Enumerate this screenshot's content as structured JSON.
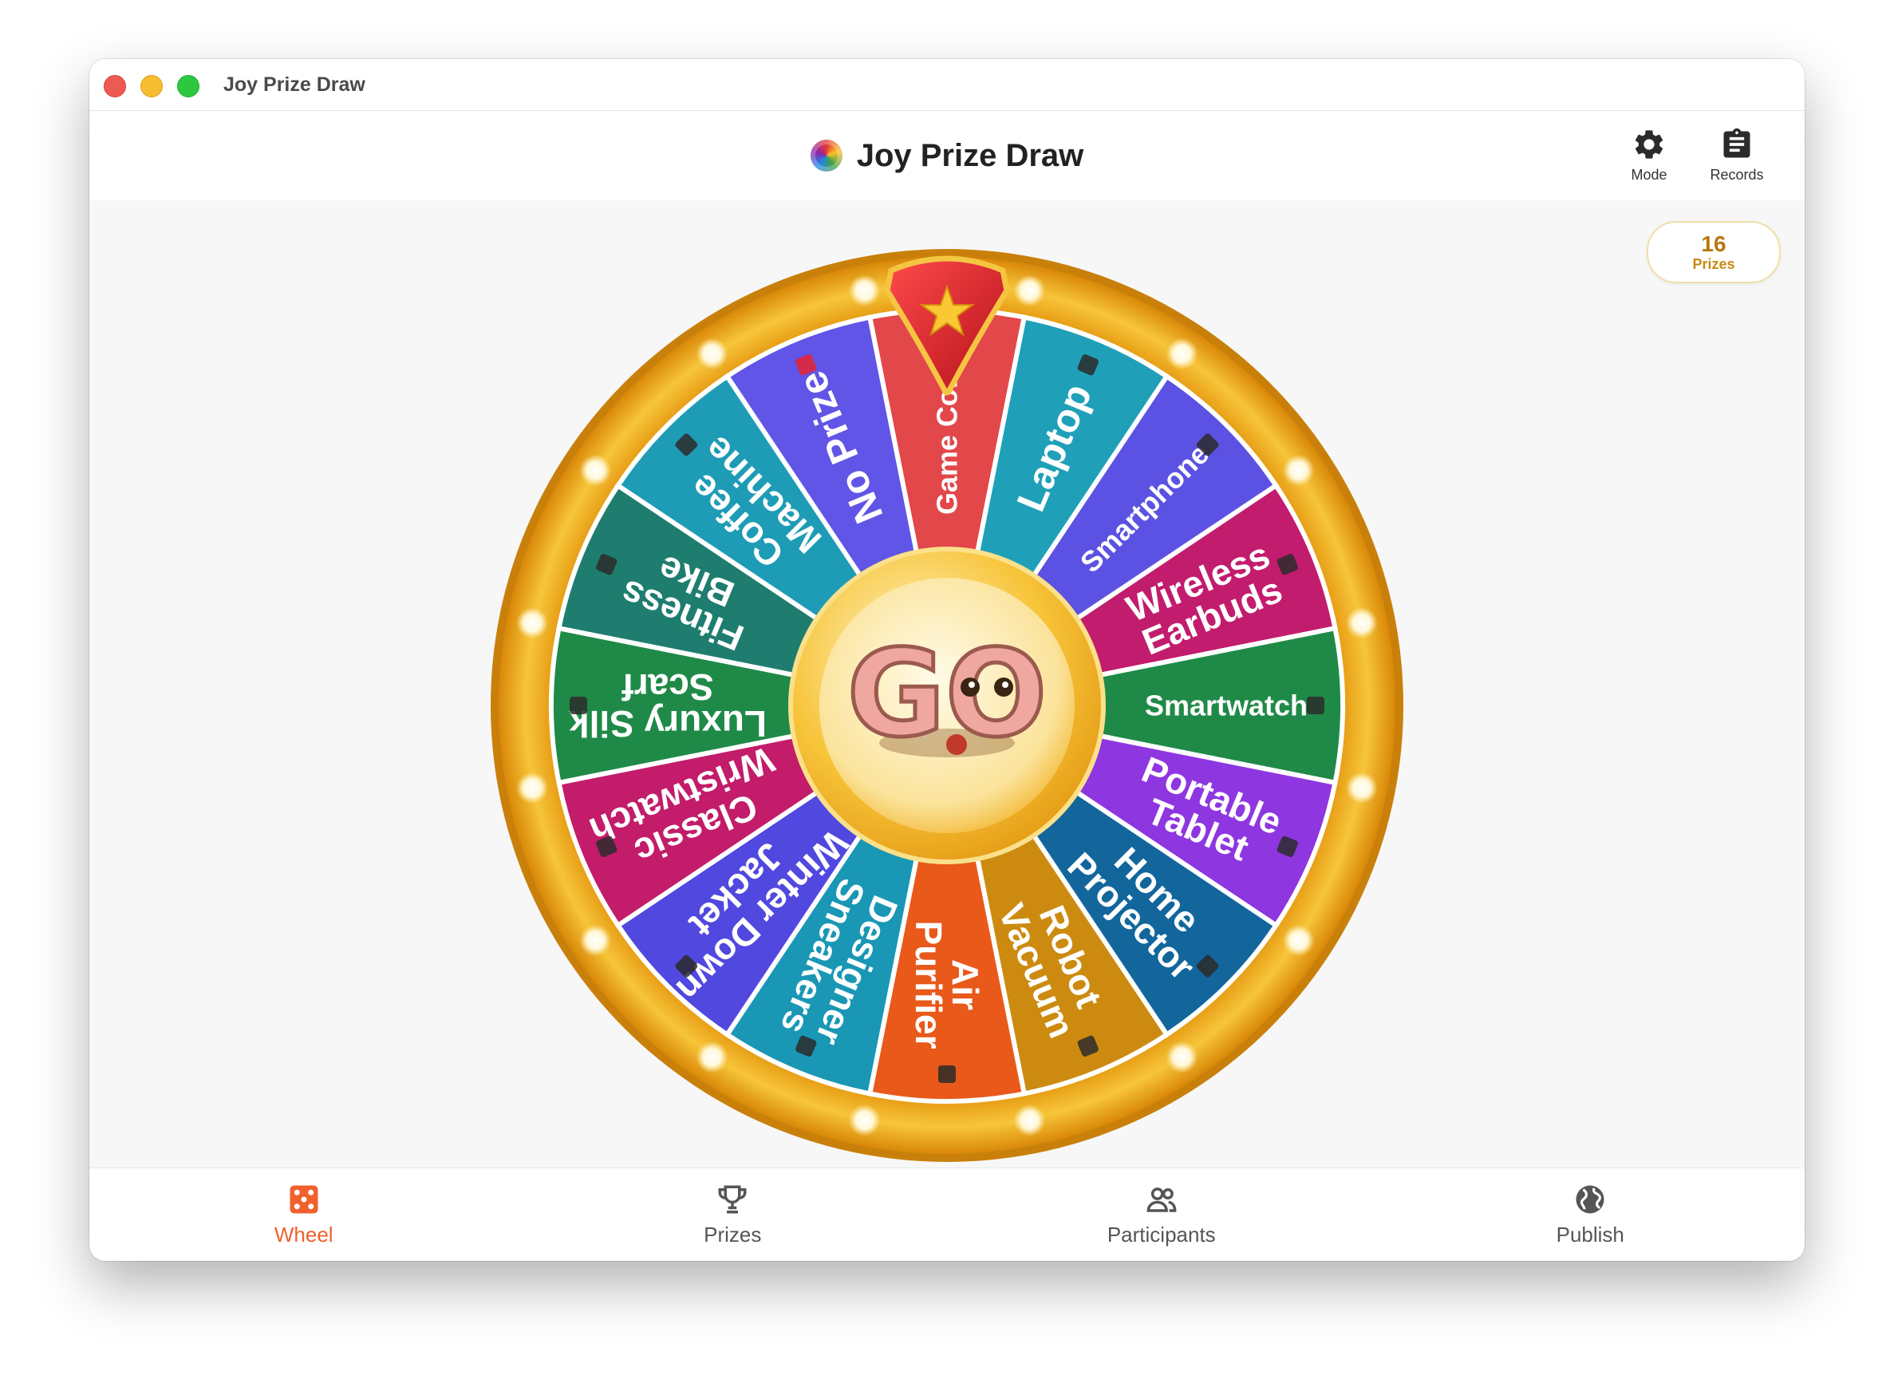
{
  "window": {
    "title": "Joy Prize Draw"
  },
  "header": {
    "title": "Joy Prize Draw",
    "logo_icon": "colorful-ball-logo",
    "buttons": [
      {
        "label": "Mode",
        "icon": "gear-icon"
      },
      {
        "label": "Records",
        "icon": "clipboard-icon"
      }
    ]
  },
  "badge": {
    "count": "16",
    "label": "Prizes"
  },
  "wheel": {
    "center_label": "GO",
    "pointer_icon": "star-icon",
    "rim_color": "#f2b623",
    "segments": [
      {
        "label": "Game Conso",
        "color": "#e2474a",
        "icon": "game-console-icon"
      },
      {
        "label": "Laptop",
        "color": "#1fa0b8",
        "icon": "laptop-icon"
      },
      {
        "label": "Smartphone",
        "color": "#5b52e3",
        "icon": "smartphone-icon"
      },
      {
        "label": "Wireless Earbuds",
        "color": "#c21c6e",
        "icon": "earbuds-icon"
      },
      {
        "label": "Smartwatch",
        "color": "#1f8a47",
        "icon": "watch-icon"
      },
      {
        "label": "Portable Tablet",
        "color": "#8e36e0",
        "icon": "tablet-icon"
      },
      {
        "label": "Home Projector",
        "color": "#12669c",
        "icon": "projector-icon"
      },
      {
        "label": "Robot Vacuum",
        "color": "#cc8b10",
        "icon": "vacuum-icon"
      },
      {
        "label": "Air Purifier",
        "color": "#e8591a",
        "icon": "purifier-icon"
      },
      {
        "label": "Designer Sneakers",
        "color": "#1997b5",
        "icon": "sneaker-icon"
      },
      {
        "label": "Winter Down Jacket",
        "color": "#5148df",
        "icon": "jacket-icon"
      },
      {
        "label": "Classic Wristwatch",
        "color": "#c21c6a",
        "icon": "wristwatch-icon"
      },
      {
        "label": "Luxury Silk Scarf",
        "color": "#1f8a48",
        "icon": "scarf-icon"
      },
      {
        "label": "Fitness Bike",
        "color": "#1e7d6e",
        "icon": "bike-icon"
      },
      {
        "label": "Coffee Machine",
        "color": "#1e9cb6",
        "icon": "coffee-machine-icon"
      },
      {
        "label": "No Prize",
        "color": "#6055e6",
        "icon": "x-mark-icon"
      }
    ]
  },
  "tabs": [
    {
      "label": "Wheel",
      "icon": "dice-icon",
      "active": true
    },
    {
      "label": "Prizes",
      "icon": "trophy-icon",
      "active": false
    },
    {
      "label": "Participants",
      "icon": "people-icon",
      "active": false
    },
    {
      "label": "Publish",
      "icon": "globe-icon",
      "active": false
    }
  ]
}
